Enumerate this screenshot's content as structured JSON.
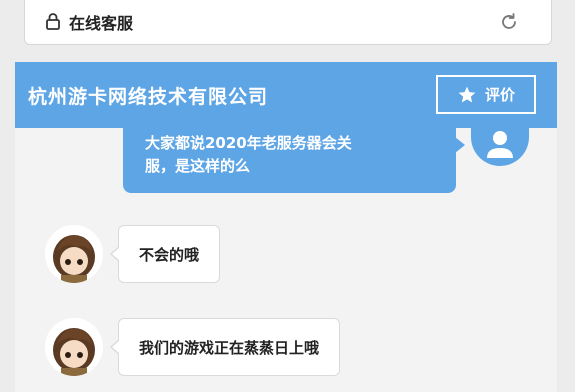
{
  "address_bar": {
    "title": "在线客服",
    "lock_icon": "lock-icon",
    "reload_icon": "refresh-icon"
  },
  "header": {
    "company": "杭州游卡网络技术有限公司",
    "rate_label": "评价",
    "rate_icon": "star-icon",
    "color": "#5ea5e6"
  },
  "messages": [
    {
      "from": "user",
      "text_line1": "大家都说2020年老服务器会关",
      "text_line2": "服，是这样的么"
    },
    {
      "from": "agent",
      "text": "不会的哦"
    },
    {
      "from": "agent",
      "text": "我们的游戏正在蒸蒸日上哦"
    }
  ]
}
